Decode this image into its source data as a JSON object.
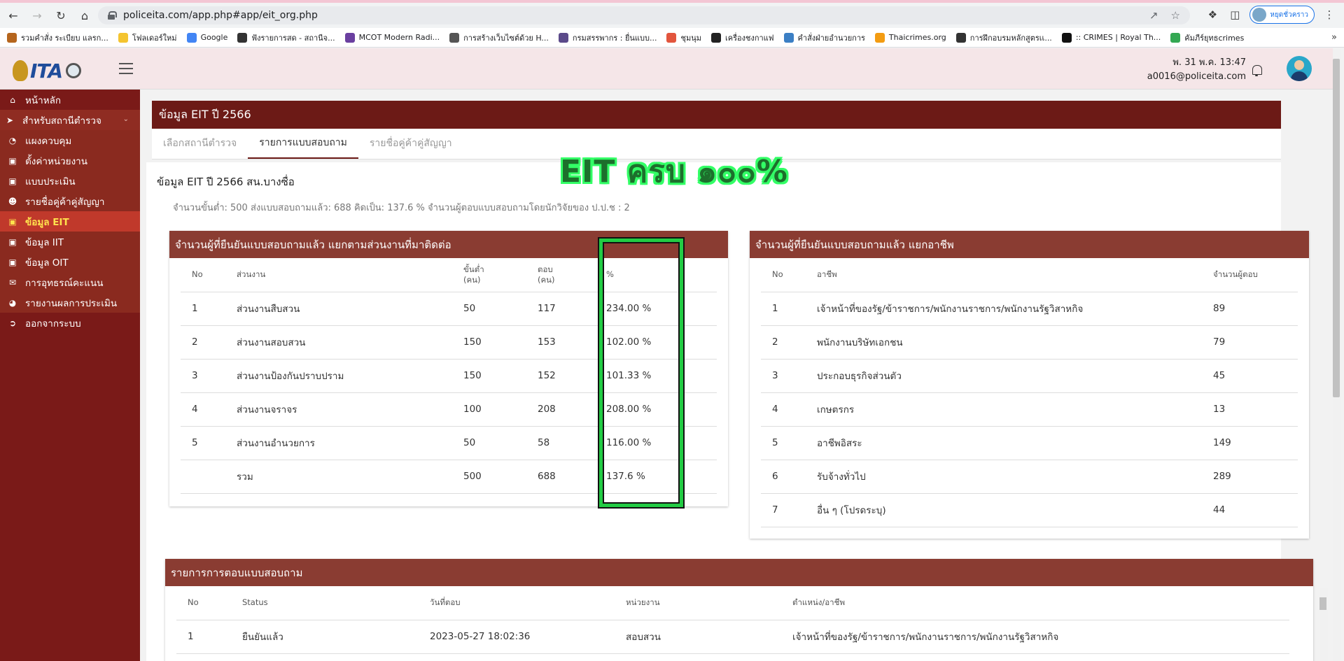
{
  "browser": {
    "url": "policeita.com/app.php#app/eit_org.php",
    "profile_label": "หยุดชั่วคราว",
    "bookmarks": [
      {
        "label": "รวมคำสั่ง ระเบียบ แลรก...",
        "color": "#b5651d"
      },
      {
        "label": "โฟลเดอร์ใหม่",
        "color": "#f4c430"
      },
      {
        "label": "Google",
        "color": "#4285f4"
      },
      {
        "label": "ฟังรายการสด - สถานีจ...",
        "color": "#333333"
      },
      {
        "label": "MCOT Modern Radi...",
        "color": "#6a3fa0"
      },
      {
        "label": "การสร้างเว็บไซต์ด้วย H...",
        "color": "#555555"
      },
      {
        "label": "กรมสรรพากร : ยื่นแบบ...",
        "color": "#5b4a8a"
      },
      {
        "label": "ชุมนุม",
        "color": "#e2553d"
      },
      {
        "label": "เครื่องชงกาแฟ",
        "color": "#222222"
      },
      {
        "label": "คำสั่งฝ่ายอำนวยการ",
        "color": "#3b7fc4"
      },
      {
        "label": "Thaicrimes.org",
        "color": "#f39c12"
      },
      {
        "label": "การฝึกอบรมหลักสูตรเเ...",
        "color": "#333333"
      },
      {
        "label": ":: CRIMES | Royal Th...",
        "color": "#111111"
      },
      {
        "label": "คัมภีร์ยุทธcrimes",
        "color": "#34a853"
      }
    ]
  },
  "header": {
    "datetime": "พ. 31 พ.ค. 13:47",
    "email": "a0016@policeita.com"
  },
  "sidebar": {
    "home": "หน้าหลัก",
    "group": "สำหรับสถานีตำรวจ",
    "items": [
      {
        "label": "แผงควบคุม",
        "icon": "dashboard-icon"
      },
      {
        "label": "ตั้งค่าหน่วยงาน",
        "icon": "briefcase-icon"
      },
      {
        "label": "แบบประเมิน",
        "icon": "briefcase-icon"
      },
      {
        "label": "รายชื่อคู่ค้าคู่สัญญา",
        "icon": "users-icon"
      },
      {
        "label": "ข้อมูล EIT",
        "icon": "briefcase-icon"
      },
      {
        "label": "ข้อมูล IIT",
        "icon": "briefcase-icon"
      },
      {
        "label": "ข้อมูล OIT",
        "icon": "briefcase-icon"
      },
      {
        "label": "การอุทธรณ์คะแนน",
        "icon": "envelope-icon"
      },
      {
        "label": "รายงานผลการประเมิน",
        "icon": "pie-chart-icon"
      }
    ],
    "logout": "ออกจากระบบ"
  },
  "page": {
    "banner": "ข้อมูล EIT ปี 2566",
    "tabs": [
      "เลือกสถานีตำรวจ",
      "รายการแบบสอบถาม",
      "รายชื่อคู่ค้าคู่สัญญา"
    ],
    "title": "ข้อมูล EIT ปี 2566 สน.บางซื่อ",
    "summary": "จำนวนขั้นต่ำ: 500 ส่งแบบสอบถามแล้ว: 688 คิดเป็น: 137.6 % จำนวนผู้ตอบแบบสอบถามโดยนักวิจัยของ ป.ป.ช : 2",
    "overlay": "EIT ครบ ๑๐๐%"
  },
  "dept_table": {
    "title": "จำนวนผู้ที่ยืนยันแบบสอบถามแล้ว แยกตามส่วนงานที่มาติดต่อ",
    "headers": {
      "no": "No",
      "dept": "ส่วนงาน",
      "min": "ขั้นต่ำ",
      "min_unit": "(คน)",
      "ans": "ตอบ",
      "ans_unit": "(คน)",
      "pct": "%"
    },
    "rows": [
      {
        "no": "1",
        "dept": "ส่วนงานสืบสวน",
        "min": "50",
        "ans": "117",
        "pct": "234.00 %"
      },
      {
        "no": "2",
        "dept": "ส่วนงานสอบสวน",
        "min": "150",
        "ans": "153",
        "pct": "102.00 %"
      },
      {
        "no": "3",
        "dept": "ส่วนงานป้องกันปราบปราม",
        "min": "150",
        "ans": "152",
        "pct": "101.33 %"
      },
      {
        "no": "4",
        "dept": "ส่วนงานจราจร",
        "min": "100",
        "ans": "208",
        "pct": "208.00 %"
      },
      {
        "no": "5",
        "dept": "ส่วนงานอำนวยการ",
        "min": "50",
        "ans": "58",
        "pct": "116.00 %"
      },
      {
        "no": "",
        "dept": "รวม",
        "min": "500",
        "ans": "688",
        "pct": "137.6 %"
      }
    ]
  },
  "career_table": {
    "title": "จำนวนผู้ที่ยืนยันแบบสอบถามแล้ว แยกอาชีพ",
    "headers": {
      "no": "No",
      "career": "อาชีพ",
      "count": "จำนวนผู้ตอบ"
    },
    "rows": [
      {
        "no": "1",
        "career": "เจ้าหน้าที่ของรัฐ/ข้าราชการ/พนักงานราชการ/พนักงานรัฐวิสาหกิจ",
        "count": "89"
      },
      {
        "no": "2",
        "career": "พนักงานบริษัทเอกชน",
        "count": "79"
      },
      {
        "no": "3",
        "career": "ประกอบธุรกิจส่วนตัว",
        "count": "45"
      },
      {
        "no": "4",
        "career": "เกษตรกร",
        "count": "13"
      },
      {
        "no": "5",
        "career": "อาชีพอิสระ",
        "count": "149"
      },
      {
        "no": "6",
        "career": "รับจ้างทั่วไป",
        "count": "289"
      },
      {
        "no": "7",
        "career": "อื่น ๆ (โปรดระบุ)",
        "count": "44"
      }
    ]
  },
  "response_table": {
    "title": "รายการการตอบแบบสอบถาม",
    "headers": {
      "no": "No",
      "status": "Status",
      "date": "วันที่ตอบ",
      "unit": "หน่วยงาน",
      "position": "ตำแหน่ง/อาชีพ"
    },
    "rows": [
      {
        "no": "1",
        "status": "ยืนยันแล้ว",
        "date": "2023-05-27 18:02:36",
        "unit": "สอบสวน",
        "position": "เจ้าหน้าที่ของรัฐ/ข้าราชการ/พนักงานราชการ/พนักงานรัฐวิสาหกิจ"
      }
    ]
  }
}
